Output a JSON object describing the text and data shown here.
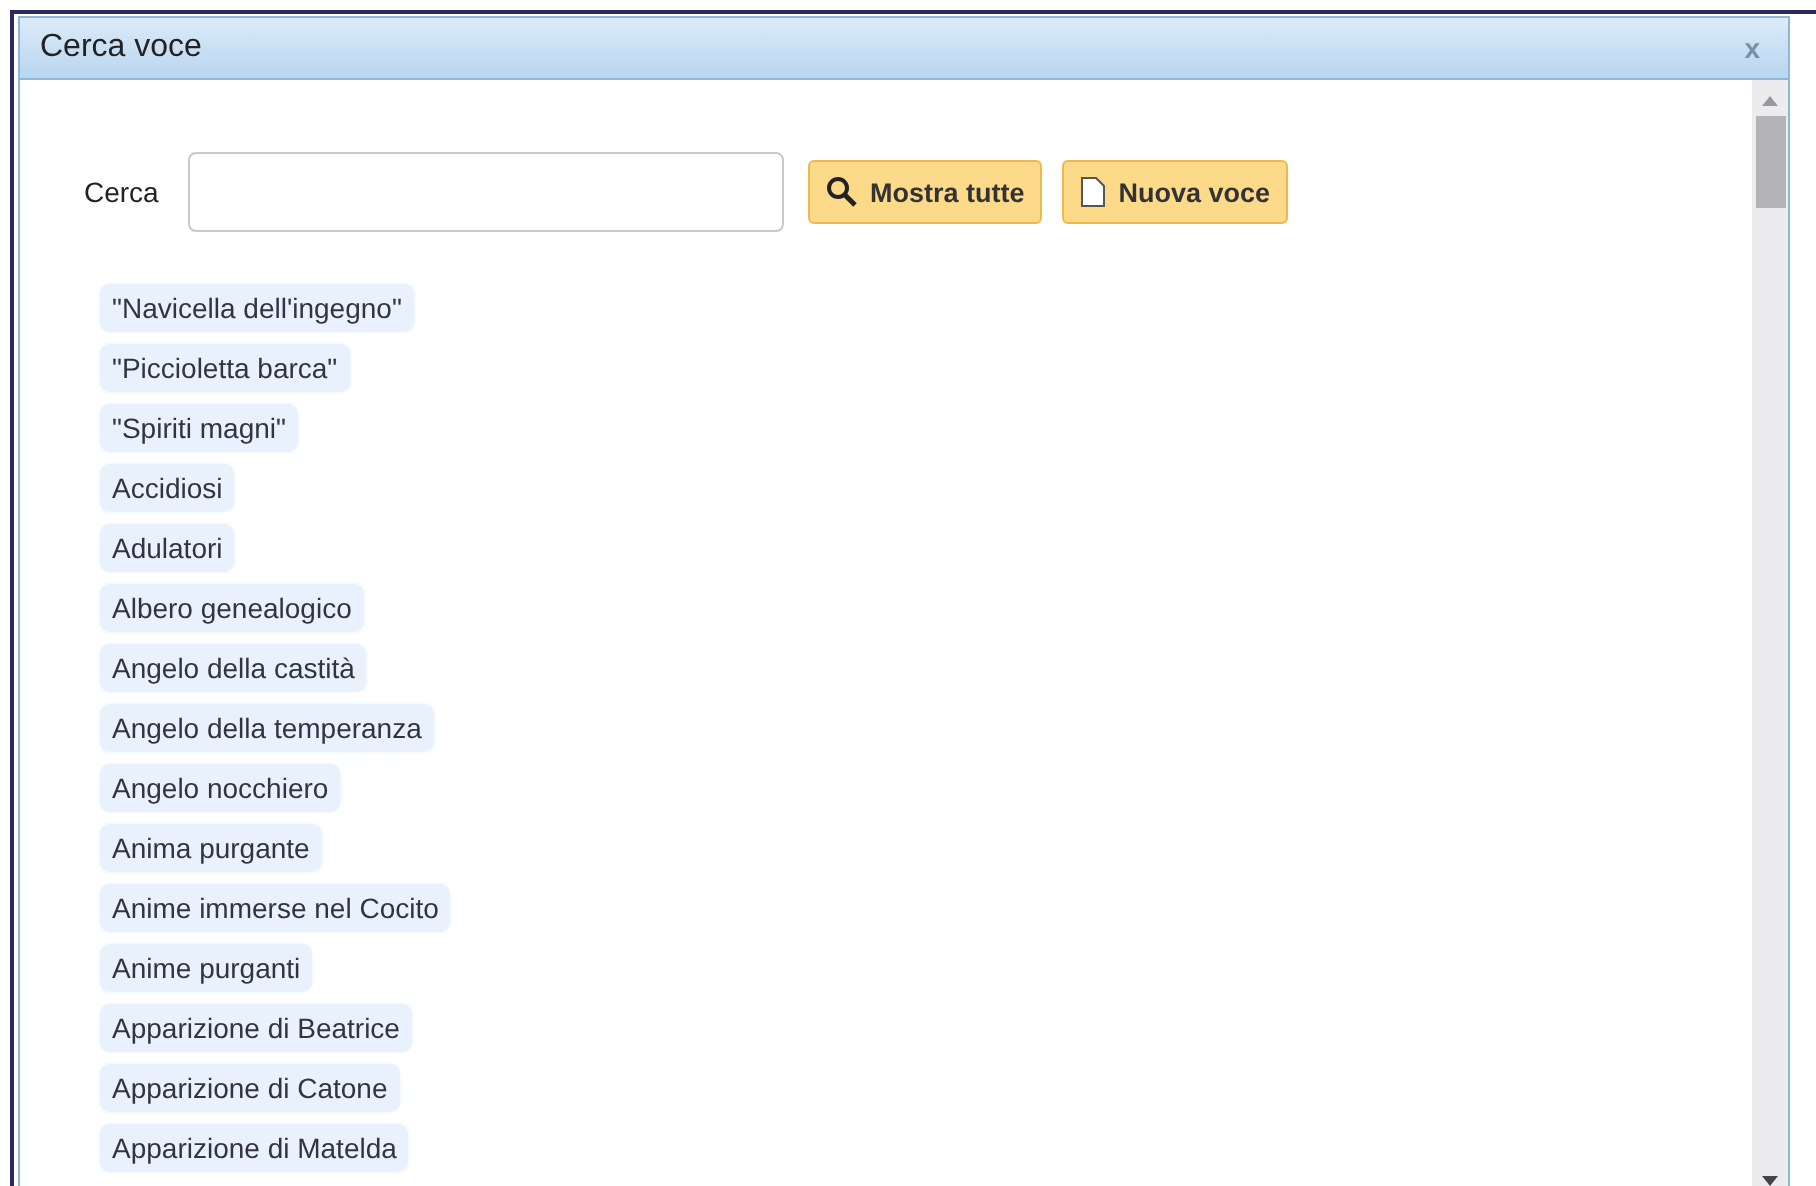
{
  "window": {
    "title": "Cerca voce",
    "close": "x"
  },
  "search": {
    "label": "Cerca"
  },
  "buttons": [
    {
      "kind": "search",
      "label": "Mostra tutte"
    },
    {
      "kind": "new",
      "label": "Nuova voce"
    }
  ],
  "entries": [
    "\"Navicella dell'ingegno\"",
    "\"Piccioletta barca\"",
    "\"Spiriti magni\"",
    "Accidiosi",
    "Adulatori",
    "Albero genealogico",
    "Angelo della castità",
    "Angelo della temperanza",
    "Angelo nocchiero",
    "Anima purgante",
    "Anime immerse nel Cocito",
    "Anime purganti",
    "Apparizione di Beatrice",
    "Apparizione di Catone",
    "Apparizione di Matelda"
  ]
}
